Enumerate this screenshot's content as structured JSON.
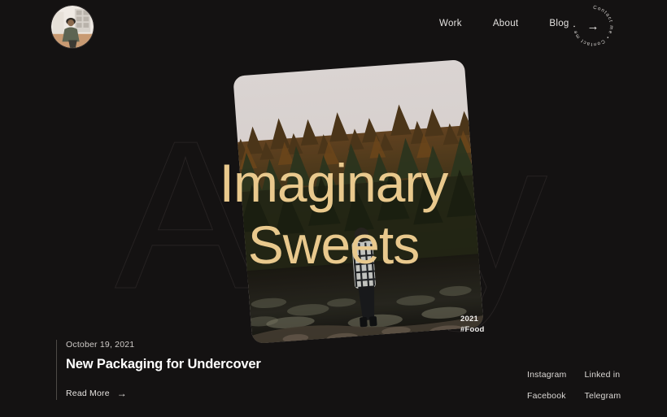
{
  "theme": {
    "background": "#141212",
    "accent_gold": "#e9c98d",
    "text_light": "#e4e2e0",
    "ghost_stroke": "#262222"
  },
  "header": {
    "avatar_alt": "profile-photo",
    "nav": [
      {
        "label": "Work"
      },
      {
        "label": "About"
      },
      {
        "label": "Blog"
      }
    ],
    "contact_badge": {
      "ring_text": "Contact me  •  Contact me  •  ",
      "arrow": "→"
    }
  },
  "background": {
    "ghost_word": "Amy"
  },
  "hero": {
    "title_line1": "Imaginary",
    "title_line2": "Sweets",
    "photo_alt": "person-standing-at-lake-in-autumn-forest",
    "meta_year": "2021",
    "meta_tag": "#Food"
  },
  "article": {
    "date": "October 19, 2021",
    "headline": "New Packaging for Undercover",
    "read_more_label": "Read More",
    "read_more_arrow": "→"
  },
  "socials": [
    {
      "label": "Instagram"
    },
    {
      "label": "Linked in"
    },
    {
      "label": "Facebook"
    },
    {
      "label": "Telegram"
    }
  ]
}
